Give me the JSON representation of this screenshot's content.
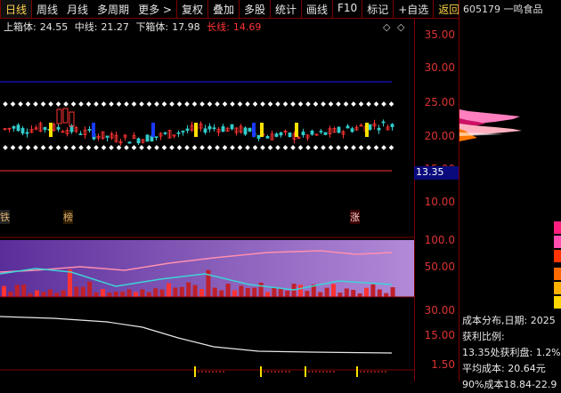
{
  "toolbar": {
    "items": [
      "日线",
      "周线",
      "月线",
      "多周期",
      "更多 >",
      "复权",
      "叠加",
      "多股",
      "统计",
      "画线",
      "F10",
      "标记",
      "+自选",
      "返回"
    ],
    "active_index": 0
  },
  "stock": {
    "code": "605179",
    "name": "一鸣食品"
  },
  "legend": {
    "upper_label": "上箱体:",
    "upper_value": "24.55",
    "mid_label": "中线:",
    "mid_value": "21.27",
    "lower_label": "下箱体:",
    "lower_value": "17.98",
    "long_label": "长线:",
    "long_value": "14.69"
  },
  "price_axis": [
    "35.00",
    "30.00",
    "25.00",
    "20.00",
    "15.00",
    "10.00"
  ],
  "current_price_tag": "13.35",
  "signals": [
    {
      "text": "铁",
      "color": "#e0b070"
    },
    {
      "text": "榜",
      "color": "#e0b070"
    },
    {
      "text": "涨",
      "color": "#ffd0d0"
    }
  ],
  "indicator_axis": [
    "100.0",
    "50.00"
  ],
  "indicator2_axis": [
    "30.00",
    "15.00"
  ],
  "indicator3_axis": [
    "1.50"
  ],
  "cost_panel": {
    "title": "成本分布,日期: 2025",
    "profit_label": "获利比例:",
    "at_price": "13.35处获利盘: 1.2%",
    "avg_cost": "平均成本: 20.64元",
    "range90": "90%成本18.84-22.9"
  },
  "colors": {
    "up": "#ff3333",
    "down": "#33cccc",
    "accent": "#ffd24a",
    "box": "#ffffff",
    "long": "#ff3333",
    "mid_line": "#1a1aff"
  }
}
